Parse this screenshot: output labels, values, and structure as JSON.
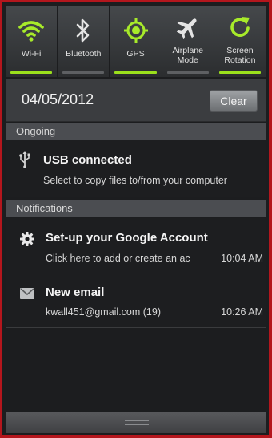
{
  "quick_settings": [
    {
      "label": "Wi-Fi",
      "icon": "wifi-icon",
      "on": true
    },
    {
      "label": "Bluetooth",
      "icon": "bluetooth-icon",
      "on": false
    },
    {
      "label": "GPS",
      "icon": "gps-icon",
      "on": true
    },
    {
      "label": "Airplane Mode",
      "icon": "airplane-icon",
      "on": false
    },
    {
      "label": "Screen Rotation",
      "icon": "rotation-icon",
      "on": true
    }
  ],
  "date_row": {
    "date": "04/05/2012",
    "clear_label": "Clear"
  },
  "ongoing": {
    "header": "Ongoing",
    "items": [
      {
        "icon": "usb-icon",
        "title": "USB connected",
        "subtitle": "Select to copy files to/from your computer"
      }
    ]
  },
  "notifications": {
    "header": "Notifications",
    "items": [
      {
        "icon": "gear-icon",
        "title": "Set-up your Google Account",
        "subtitle": "Click here to add or create an ac",
        "time": "10:04 AM"
      },
      {
        "icon": "email-icon",
        "title": "New email",
        "subtitle": "kwall451@gmail.com (19)",
        "time": "10:26 AM"
      }
    ]
  },
  "colors": {
    "accent_on": "#9be01c",
    "frame_border": "#b4161d",
    "panel_bg": "#1c1d1f"
  }
}
